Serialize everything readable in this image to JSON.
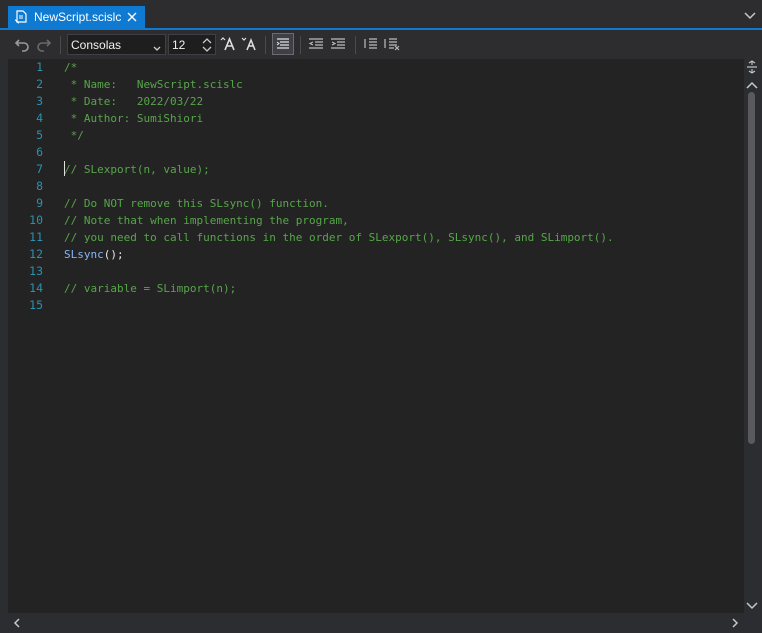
{
  "tab": {
    "title": "NewScript.scislc"
  },
  "toolbar": {
    "font_name": "Consolas",
    "font_size": "12"
  },
  "editor": {
    "line_numbers": [
      "1",
      "2",
      "3",
      "4",
      "5",
      "6",
      "7",
      "8",
      "9",
      "10",
      "11",
      "12",
      "13",
      "14",
      "15"
    ],
    "lines": [
      "/*",
      " * Name:   NewScript.scislc",
      " * Date:   2022/03/22",
      " * Author: SumiShiori",
      " */",
      "",
      "// SLexport(n, value);",
      "",
      "// Do NOT remove this SLsync() function.",
      "// Note that when implementing the program,",
      "// you need to call functions in the order of SLexport(), SLsync(), and SLimport().",
      "",
      "",
      "// variable = SLimport(n);",
      ""
    ],
    "line12": {
      "fn": "SLsync",
      "rest": "();"
    }
  },
  "colors": {
    "accent": "#0e7ad1",
    "comment": "#57a64a",
    "line_number": "#2b91af",
    "editor_bg": "#232323"
  },
  "icons": [
    "script-file-icon",
    "close-icon",
    "chevron-down-icon",
    "undo-icon",
    "redo-icon",
    "increase-font-icon",
    "decrease-font-icon",
    "word-wrap-icon",
    "outdent-icon",
    "indent-icon",
    "comment-icon",
    "uncomment-icon",
    "split-icon",
    "scroll-up-icon",
    "scroll-down-icon",
    "scroll-left-icon",
    "scroll-right-icon"
  ]
}
